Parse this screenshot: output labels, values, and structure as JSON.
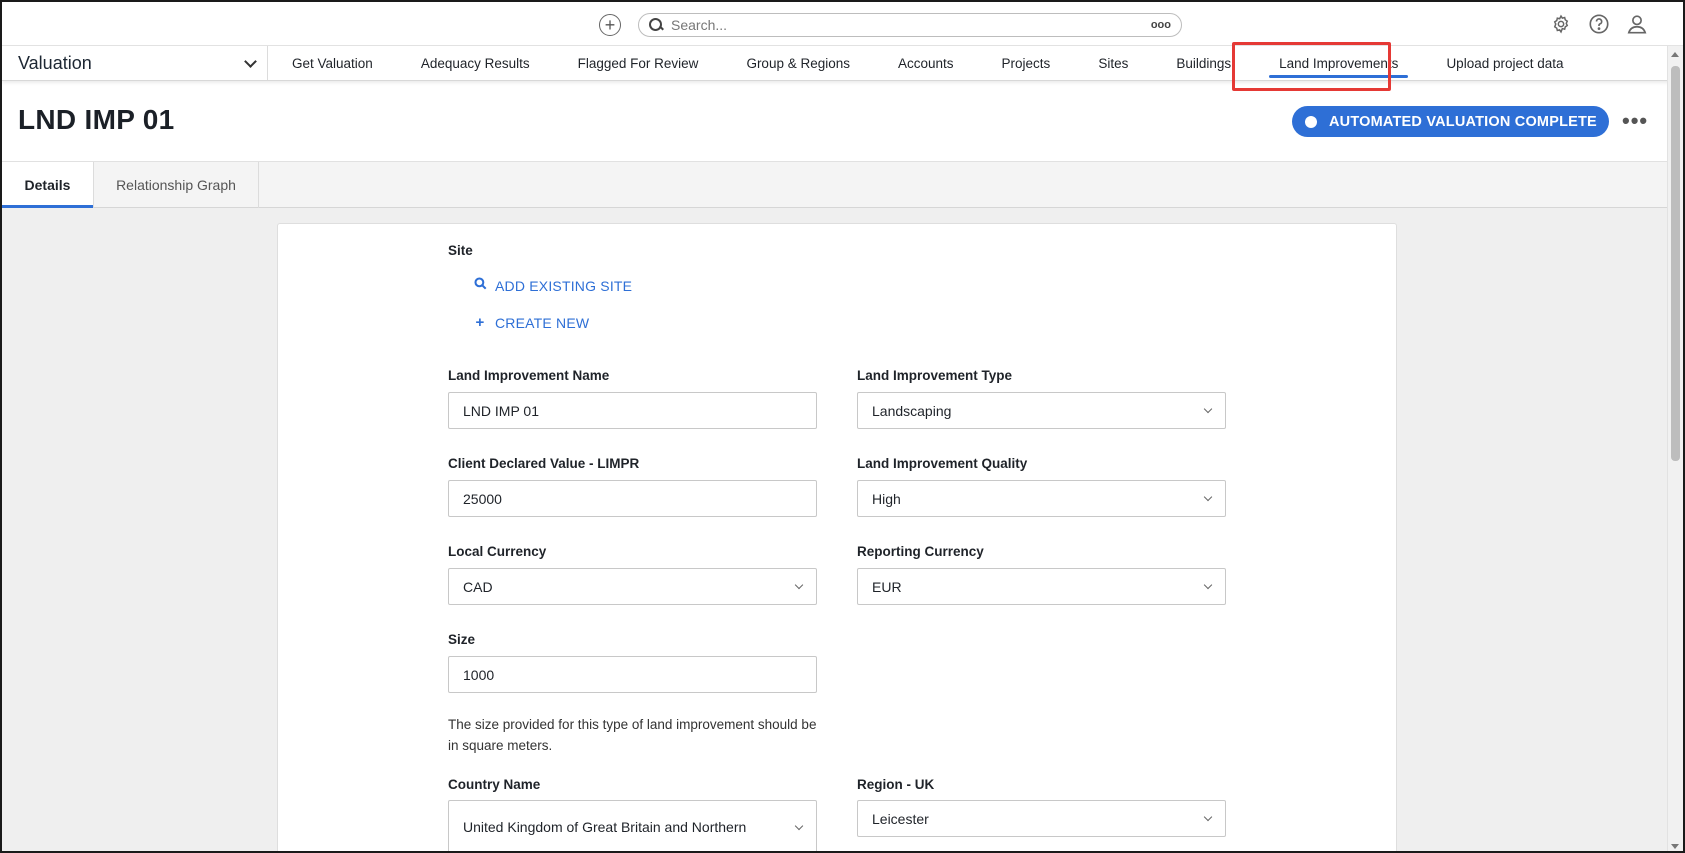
{
  "topbar": {
    "search_placeholder": "Search...",
    "search_more": "ooo",
    "icons": [
      "plus-circle-icon",
      "search-icon",
      "settings-icon",
      "help-icon",
      "user-icon"
    ]
  },
  "app": {
    "name": "Valuation"
  },
  "nav": {
    "items": [
      "Get Valuation",
      "Adequacy Results",
      "Flagged For Review",
      "Group & Regions",
      "Accounts",
      "Projects",
      "Sites",
      "Buildings",
      "Land Improvements",
      "Upload project data"
    ],
    "active": "Land Improvements"
  },
  "header": {
    "title": "LND IMP 01",
    "status": "AUTOMATED VALUATION COMPLETE",
    "more": "•••"
  },
  "tabs": {
    "details": "Details",
    "relationship_graph": "Relationship Graph"
  },
  "form": {
    "site_label": "Site",
    "add_existing_site": "ADD EXISTING SITE",
    "create_new": "CREATE NEW",
    "land_improvement_name_label": "Land Improvement Name",
    "land_improvement_name_value": "LND IMP 01",
    "land_improvement_type_label": "Land Improvement Type",
    "land_improvement_type_value": "Landscaping",
    "client_declared_value_label": "Client Declared Value - LIMPR",
    "client_declared_value_value": "25000",
    "land_improvement_quality_label": "Land Improvement Quality",
    "land_improvement_quality_value": "High",
    "local_currency_label": "Local Currency",
    "local_currency_value": "CAD",
    "reporting_currency_label": "Reporting Currency",
    "reporting_currency_value": "EUR",
    "size_label": "Size",
    "size_value": "1000",
    "size_help": "The size provided for this type of land improvement should be in square meters.",
    "country_name_label": "Country Name",
    "country_name_value": "United Kingdom of Great Britain and Northern Ireland (the)",
    "region_label": "Region - UK",
    "region_value": "Leicester"
  },
  "colors": {
    "accent": "#2e6fd6",
    "highlight_box": "#e53935"
  }
}
